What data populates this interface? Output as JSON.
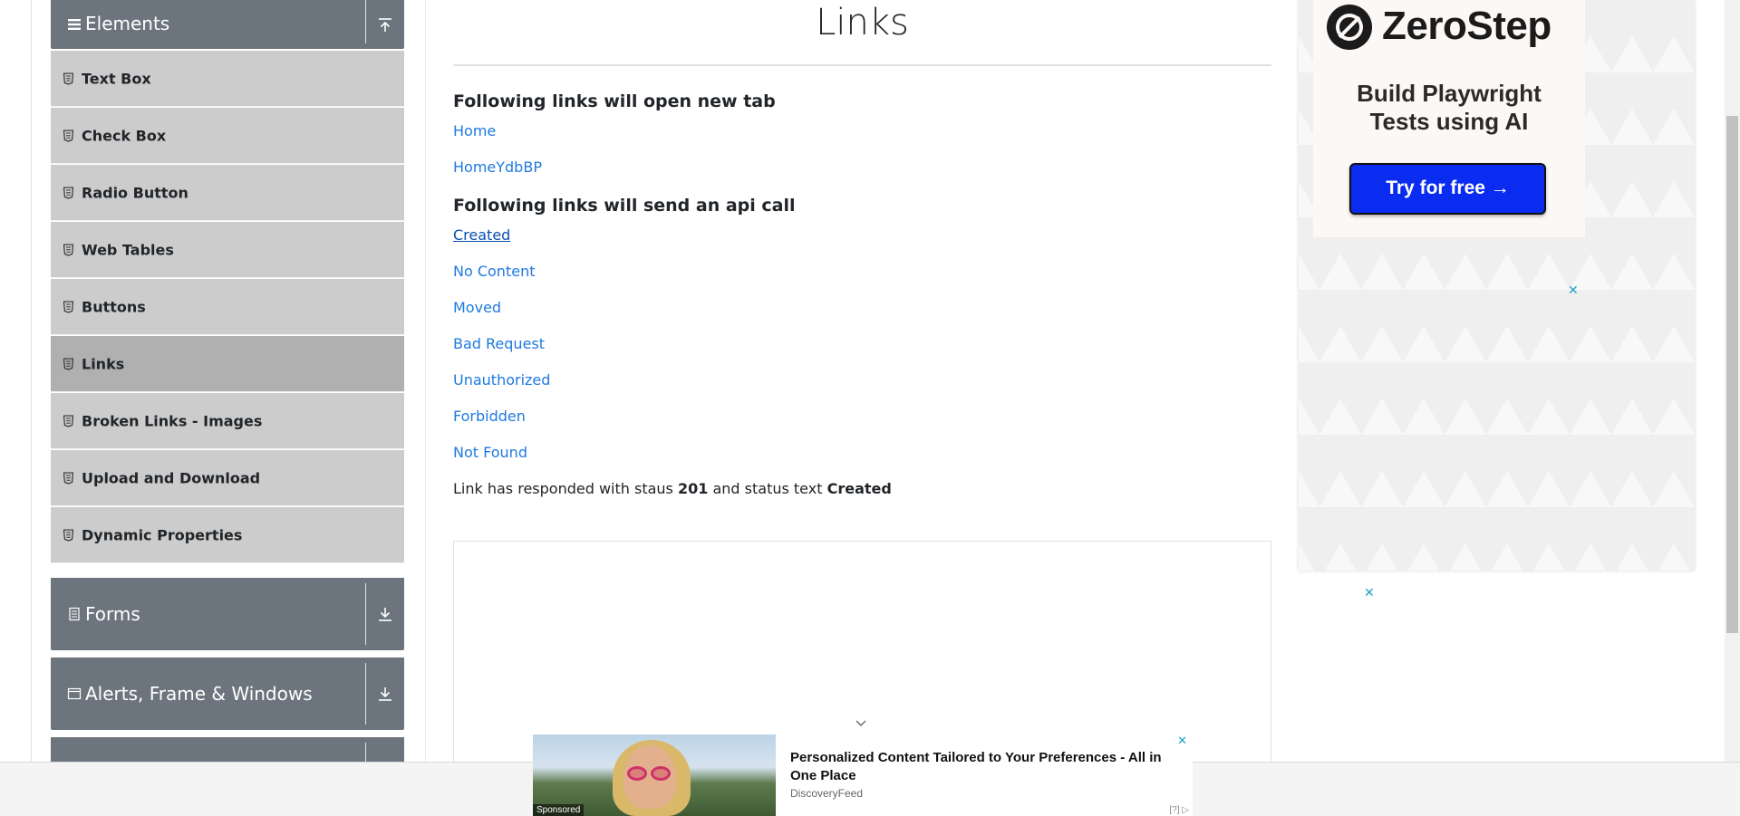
{
  "sidebar": {
    "elements_header": {
      "label": "Elements",
      "icon": "menu-icon",
      "toggle_icon": "upload-arrow-icon"
    },
    "items": [
      {
        "label": "Text Box",
        "active": false
      },
      {
        "label": "Check Box",
        "active": false
      },
      {
        "label": "Radio Button",
        "active": false
      },
      {
        "label": "Web Tables",
        "active": false
      },
      {
        "label": "Buttons",
        "active": false
      },
      {
        "label": "Links",
        "active": true
      },
      {
        "label": "Broken Links - Images",
        "active": false
      },
      {
        "label": "Upload and Download",
        "active": false
      },
      {
        "label": "Dynamic Properties",
        "active": false
      }
    ],
    "groups": [
      {
        "label": "Forms",
        "icon": "document-icon",
        "toggle_icon": "download-arrow-icon"
      },
      {
        "label": "Alerts, Frame & Windows",
        "icon": "window-icon",
        "toggle_icon": "download-arrow-icon"
      }
    ]
  },
  "main": {
    "title": "Links",
    "new_tab_heading": "Following links will open new tab",
    "new_tab_links": [
      "Home",
      "HomeYdbBP"
    ],
    "api_heading": "Following links will send an api call",
    "api_links": [
      "Created",
      "No Content",
      "Moved",
      "Bad Request",
      "Unauthorized",
      "Forbidden",
      "Not Found"
    ],
    "response": {
      "prefix": "Link has responded with staus",
      "status_code": "201",
      "middle": "and status text",
      "status_text": "Created"
    }
  },
  "right_ad": {
    "brand": "ZeroStep",
    "tagline_line1": "Build Playwright",
    "tagline_line2": "Tests using AI",
    "button": "Try for free →",
    "close": "✕"
  },
  "bottom_ad": {
    "title": "Personalized Content Tailored to Your Preferences - All in One Place",
    "source": "DiscoveryFeed",
    "sponsored": "Sponsored",
    "info": "[?]",
    "close": "✕"
  },
  "colors": {
    "link": "#1f7ae0",
    "sidebar_header": "#6c757d",
    "menu_item": "#cccccc",
    "menu_item_active": "#b0b0b0",
    "ad_button": "#0a2cf0"
  }
}
